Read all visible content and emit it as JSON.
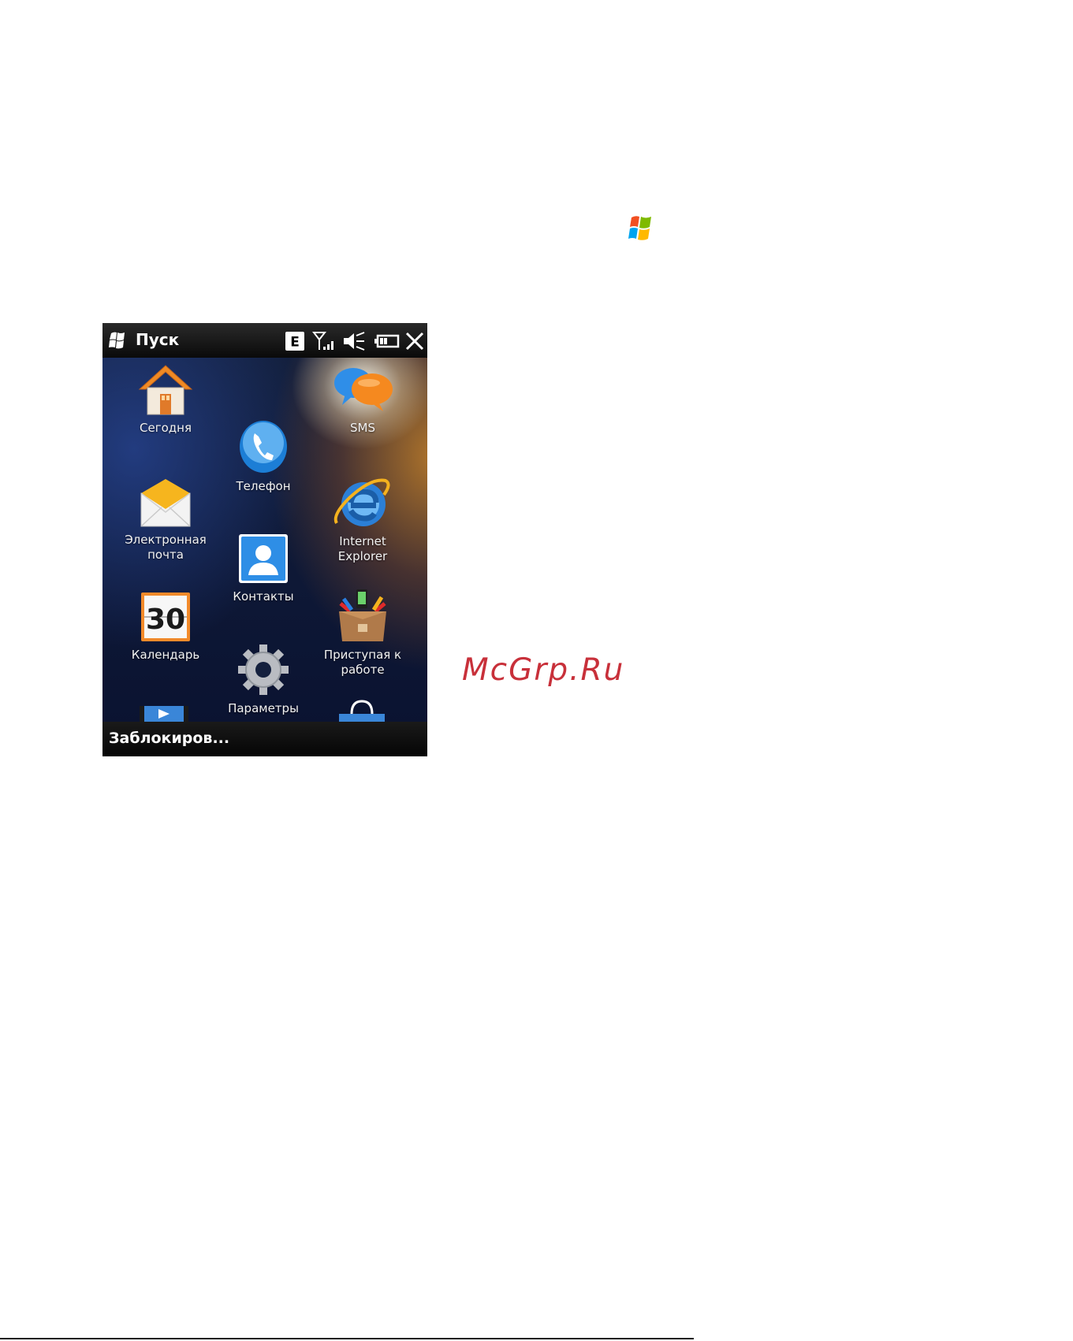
{
  "phone": {
    "title": "Пуск",
    "status": {
      "network_badge": "E",
      "icons": [
        "signal-icon",
        "speaker-muted-icon",
        "battery-icon",
        "close-icon"
      ]
    },
    "tiles": [
      {
        "name": "today",
        "label": "Сегодня",
        "icon": "house-icon"
      },
      {
        "name": "phone",
        "label": "Телефон",
        "icon": "phone-handset-icon"
      },
      {
        "name": "sms",
        "label": "SMS",
        "icon": "chat-bubbles-icon"
      },
      {
        "name": "email",
        "label": "Электронная\nпочта",
        "icon": "envelope-icon"
      },
      {
        "name": "internet-explorer",
        "label": "Internet Explorer",
        "icon": "internet-explorer-icon"
      },
      {
        "name": "contacts",
        "label": "Контакты",
        "icon": "contact-card-icon"
      },
      {
        "name": "calendar",
        "label": "Календарь",
        "icon": "calendar-icon",
        "day": "30"
      },
      {
        "name": "getting-started",
        "label": "Приступая к\nработе",
        "icon": "getting-started-box-icon"
      },
      {
        "name": "settings",
        "label": "Параметры",
        "icon": "gear-icon"
      }
    ],
    "bottom_left": "Заблокиров..."
  },
  "watermark": "McGrp.Ru",
  "colors": {
    "watermark": "#c8303a",
    "phone_bg": "#0f1a38",
    "bar_bg": "#0a0a0a"
  }
}
